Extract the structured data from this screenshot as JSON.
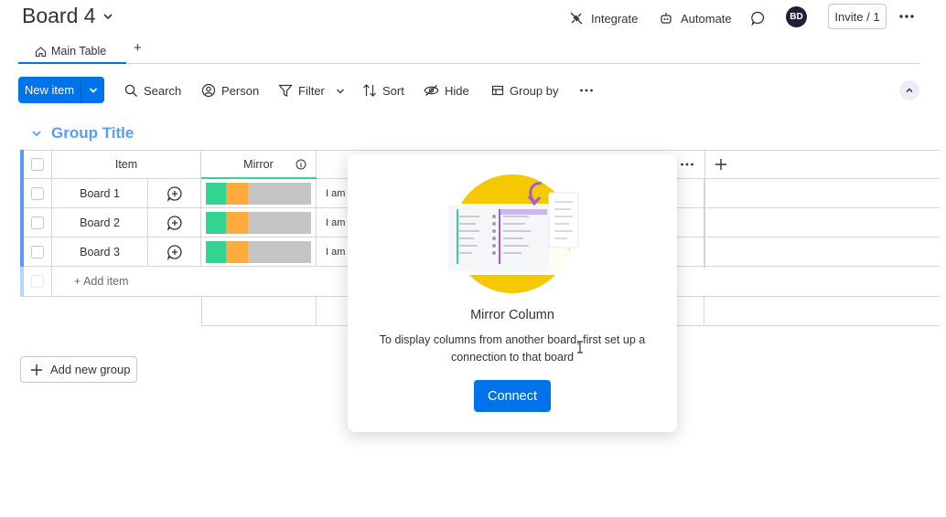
{
  "header": {
    "board_title": "Board 4",
    "integrate_label": "Integrate",
    "automate_label": "Automate",
    "avatar_initials": "BD",
    "invite_label": "Invite / 1"
  },
  "tabs": {
    "main_label": "Main Table",
    "add_label": "+"
  },
  "toolbar": {
    "new_item_label": "New item",
    "search_label": "Search",
    "person_label": "Person",
    "filter_label": "Filter",
    "sort_label": "Sort",
    "hide_label": "Hide",
    "group_by_label": "Group by"
  },
  "group": {
    "title": "Group Title",
    "color": "#579bfc",
    "columns": {
      "item": "Item",
      "mirror": "Mirror"
    },
    "rows": [
      {
        "name": "Board 1",
        "text": "I am"
      },
      {
        "name": "Board 2",
        "text": "I am"
      },
      {
        "name": "Board 3",
        "text": "I am"
      }
    ],
    "add_item_label": "+ Add item",
    "mirror_colors": [
      "#33d391",
      "#fdab3d",
      "#c4c4c4"
    ]
  },
  "popup": {
    "title": "Mirror Column",
    "description": "To display columns from another board, first set up a connection to that board",
    "connect_label": "Connect"
  },
  "add_group_label": "Add new group",
  "colors": {
    "primary": "#0073ea",
    "group": "#579bfc",
    "avatar_bg": "#1f1f3a"
  }
}
